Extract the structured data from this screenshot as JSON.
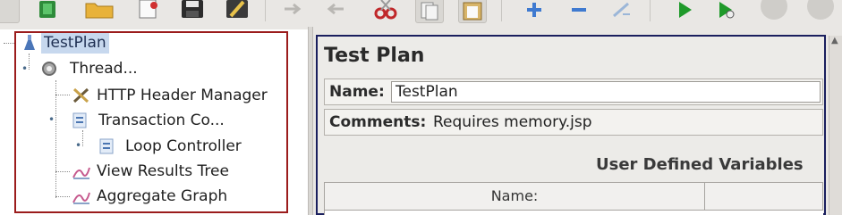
{
  "toolbar": {
    "icons": [
      "new-icon",
      "templates-icon",
      "open-icon",
      "open-recent-icon",
      "save-icon",
      "save-as-icon",
      "expand-icon",
      "collapse-icon",
      "cut-icon",
      "copy-icon",
      "paste-icon",
      "add-icon",
      "remove-icon",
      "clear-icon",
      "start-icon",
      "start-no-pause-icon",
      "stop-icon",
      "shutdown-icon"
    ]
  },
  "tree": {
    "nodes": [
      {
        "label": "TestPlan",
        "icon": "test-plan-icon",
        "selected": true
      },
      {
        "label": "Thread...",
        "icon": "thread-group-icon"
      },
      {
        "label": "HTTP Header Manager",
        "icon": "config-element-icon"
      },
      {
        "label": "Transaction Co...",
        "icon": "controller-icon"
      },
      {
        "label": "Loop Controller",
        "icon": "controller-icon"
      },
      {
        "label": "View Results Tree",
        "icon": "listener-icon"
      },
      {
        "label": "Aggregate Graph",
        "icon": "listener-icon"
      }
    ]
  },
  "panel": {
    "title": "Test Plan",
    "name_label": "Name:",
    "name_value": "TestPlan",
    "comments_label": "Comments:",
    "comments_value": "Requires memory.jsp",
    "udv_title": "User Defined Variables",
    "table_col_name": "Name:"
  },
  "colors": {
    "tree_frame": "#9b1c1c",
    "panel_frame": "#1a1f5e",
    "selection": "#c7d8ee"
  }
}
